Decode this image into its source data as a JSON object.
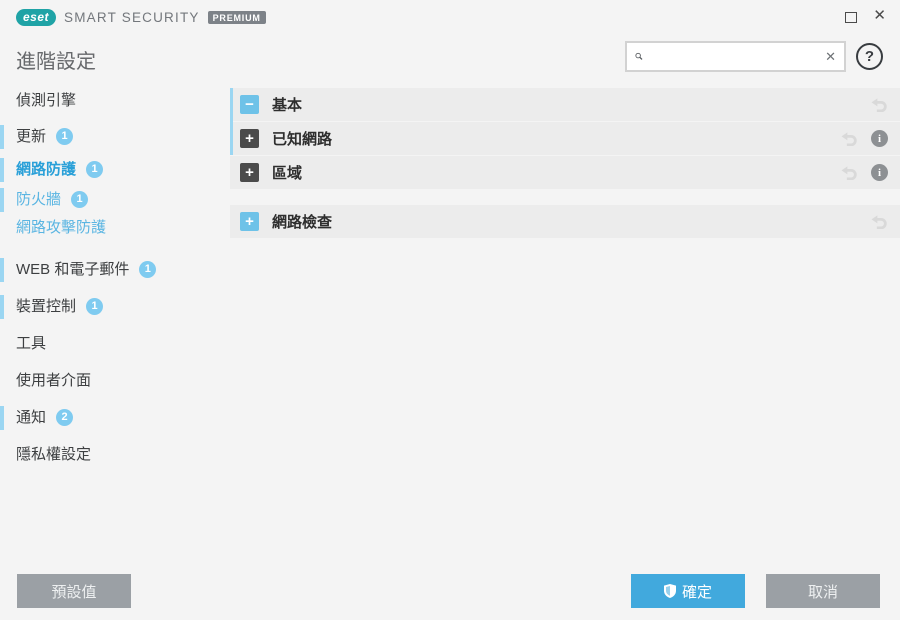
{
  "titlebar": {
    "brand": "eset",
    "product": "SMART SECURITY",
    "edition": "PREMIUM"
  },
  "header": {
    "title": "進階設定",
    "search": {
      "value": "",
      "placeholder": ""
    }
  },
  "symbols": {
    "close": "✕",
    "clear": "✕",
    "help": "?",
    "minus": "−",
    "plus": "+",
    "info": "i"
  },
  "sidebar": {
    "items": [
      {
        "label": "偵測引擎",
        "badge": ""
      },
      {
        "label": "更新",
        "badge": "1"
      },
      {
        "label": "網路防護",
        "badge": "1",
        "active": true
      },
      {
        "label": "防火牆",
        "badge": "1"
      },
      {
        "label": "網路攻擊防護",
        "badge": ""
      },
      {
        "label": "WEB 和電子郵件",
        "badge": "1"
      },
      {
        "label": "裝置控制",
        "badge": "1"
      },
      {
        "label": "工具",
        "badge": ""
      },
      {
        "label": "使用者介面",
        "badge": ""
      },
      {
        "label": "通知",
        "badge": "2"
      },
      {
        "label": "隱私權設定",
        "badge": ""
      }
    ]
  },
  "main": {
    "rows": [
      {
        "label": "基本",
        "toggle": "minus",
        "expanded": true
      },
      {
        "label": "已知網路",
        "toggle": "plus",
        "has_info": true
      },
      {
        "label": "區域",
        "toggle": "plus",
        "has_info": true
      },
      {
        "label": "網路檢查",
        "toggle": "plus"
      }
    ]
  },
  "footer": {
    "default_label": "預設值",
    "ok_label": "確定",
    "cancel_label": "取消"
  },
  "colors": {
    "accent_blue": "#41a9dd",
    "light_blue": "#7fcbf0",
    "indicator_blue": "#9bd6f2",
    "active_text": "#2aa0d8",
    "sub_text": "#5ab5e2",
    "row_bg": "#ececec",
    "window_bg": "#f4f4f4",
    "brand_teal": "#1fa3a6",
    "gray_button": "#9ba0a5",
    "dark_toggle": "#4b4b4b"
  }
}
